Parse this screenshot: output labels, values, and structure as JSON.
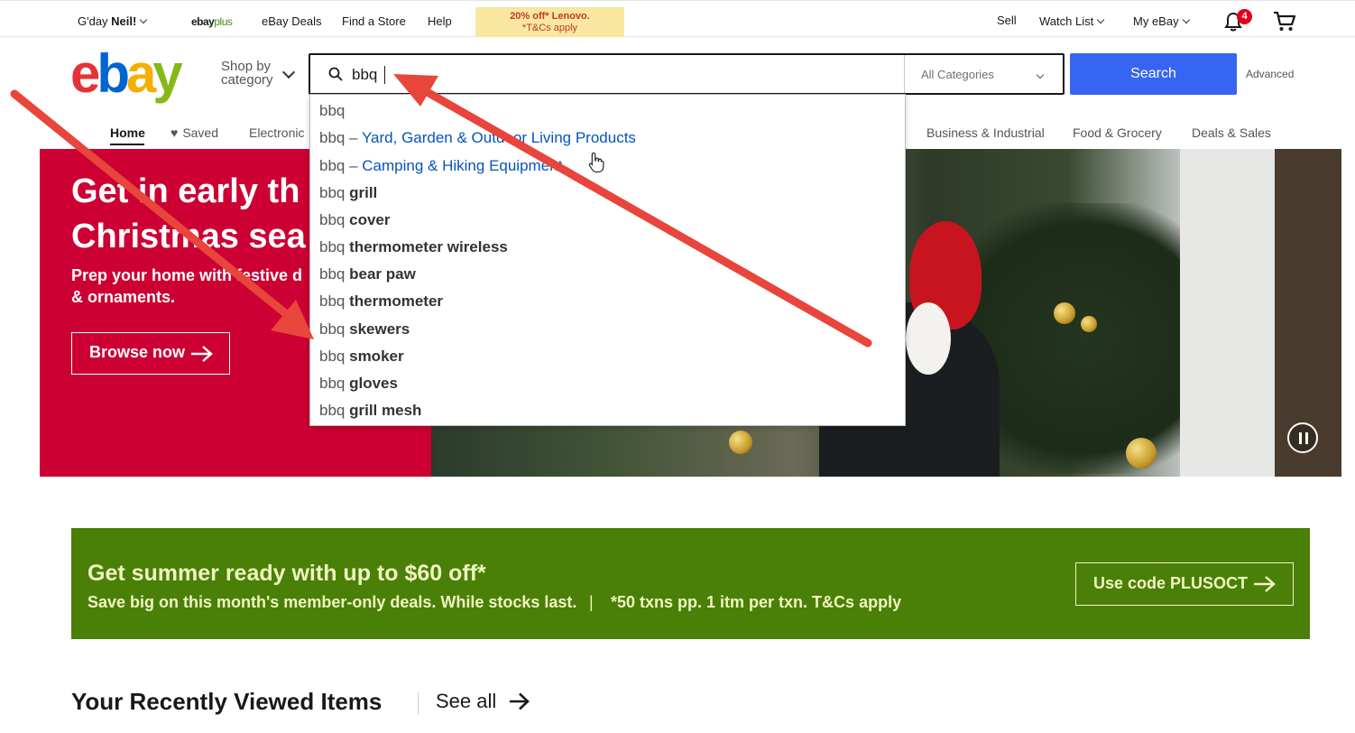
{
  "topbar": {
    "greeting_prefix": "G'day ",
    "greeting_name": "Neil!",
    "ebayplus_a": "ebay",
    "ebayplus_b": "plus",
    "deals": "eBay Deals",
    "store": "Find a Store",
    "help": "Help",
    "promo_line1": "20% off* Lenovo.",
    "promo_line2": "*T&Cs apply",
    "sell": "Sell",
    "watchlist": "Watch List",
    "myebay": "My eBay",
    "notification_count": "4"
  },
  "header": {
    "logo": [
      "e",
      "b",
      "a",
      "y"
    ],
    "shop_by_line1": "Shop by",
    "shop_by_line2": "category",
    "search_value": "bbq",
    "category_selected": "All Categories",
    "search_button": "Search",
    "advanced": "Advanced"
  },
  "nav": {
    "home": "Home",
    "saved": "Saved",
    "electronics": "Electronic",
    "business": "Business & Industrial",
    "food": "Food & Grocery",
    "deals": "Deals & Sales"
  },
  "suggestions": [
    {
      "prefix": "bbq",
      "rest": "",
      "kind": "plain"
    },
    {
      "prefix": "bbq",
      "rest": "Yard, Garden & Outdoor Living Products",
      "kind": "category"
    },
    {
      "prefix": "bbq",
      "rest": "Camping & Hiking Equipment",
      "kind": "category"
    },
    {
      "prefix": "bbq",
      "rest": "grill",
      "kind": "bold"
    },
    {
      "prefix": "bbq",
      "rest": "cover",
      "kind": "bold"
    },
    {
      "prefix": "bbq",
      "rest": "thermometer wireless",
      "kind": "bold"
    },
    {
      "prefix": "bbq",
      "rest": "bear paw",
      "kind": "bold"
    },
    {
      "prefix": "bbq",
      "rest": "thermometer",
      "kind": "bold"
    },
    {
      "prefix": "bbq",
      "rest": "skewers",
      "kind": "bold"
    },
    {
      "prefix": "bbq",
      "rest": "smoker",
      "kind": "bold"
    },
    {
      "prefix": "bbq",
      "rest": "gloves",
      "kind": "bold"
    },
    {
      "prefix": "bbq",
      "rest": "grill mesh",
      "kind": "bold"
    }
  ],
  "hero": {
    "title_line1": "Get in early th",
    "title_line2": "Christmas sea",
    "sub_line1": "Prep your home with festive d",
    "sub_line2": "& ornaments.",
    "button": "Browse now"
  },
  "promo_banner": {
    "title": "Get summer ready with up to $60 off*",
    "subtitle": "Save big on this month's member-only deals. While stocks last.",
    "separator": "|",
    "note": "*50 txns pp. 1 itm per txn.  T&Cs apply",
    "button": "Use code PLUSOCT"
  },
  "recent": {
    "title": "Your Recently Viewed Items",
    "see_all": "See all"
  },
  "colors": {
    "ebay_red": "#e53238",
    "ebay_blue": "#0064d2",
    "ebay_yellow": "#f5af02",
    "ebay_green": "#86b817",
    "search_blue": "#3665f3",
    "hero_red": "#cc0033",
    "banner_green": "#4a7f08",
    "annotation_red": "#e8453c"
  }
}
